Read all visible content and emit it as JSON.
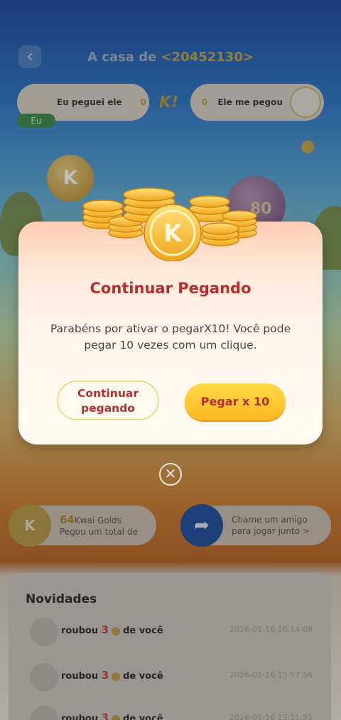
{
  "header": {
    "back_icon": "chevron-left-icon",
    "title_prefix": "A casa de ",
    "title_uid": "<20452130>"
  },
  "scoreboard": {
    "left_label": "Eu peguei ele",
    "left_value": "0",
    "vs": "K!",
    "right_value": "0",
    "right_label": "Ele me pegou",
    "me_badge": "Eu"
  },
  "scene": {
    "orb_value": "80",
    "kcoin_letter": "K"
  },
  "modal": {
    "title": "Continuar Pegando",
    "message": "Parabéns por ativar o pegarX10! Você pode pegar 10 vezes com um clique.",
    "secondary_label_line1": "Continuar",
    "secondary_label_line2": "pegando",
    "primary_label": "Pegar x 10",
    "close_icon": "close-icon"
  },
  "info": {
    "left_amount": "64",
    "left_unit": "Kwai Golds",
    "left_caption": "Pegou um total de",
    "right_line1": "Chame um amigo",
    "right_line2": "para jogar junto >"
  },
  "news": {
    "title": "Novidades",
    "rows": [
      {
        "prefix": "roubou",
        "count": "3",
        "suffix": "de você",
        "time": "2026-01-16 16:14:08"
      },
      {
        "prefix": "roubou",
        "count": "3",
        "suffix": "de você",
        "time": "2026-01-16 15:57:56"
      },
      {
        "prefix": "roubou",
        "count": "3",
        "suffix": "de você",
        "time": "2026-01-16 15:11:55"
      }
    ]
  },
  "colors": {
    "accent_red": "#b4302e",
    "gold": "#ffc12a",
    "modal_bg": "#fff6ec"
  }
}
